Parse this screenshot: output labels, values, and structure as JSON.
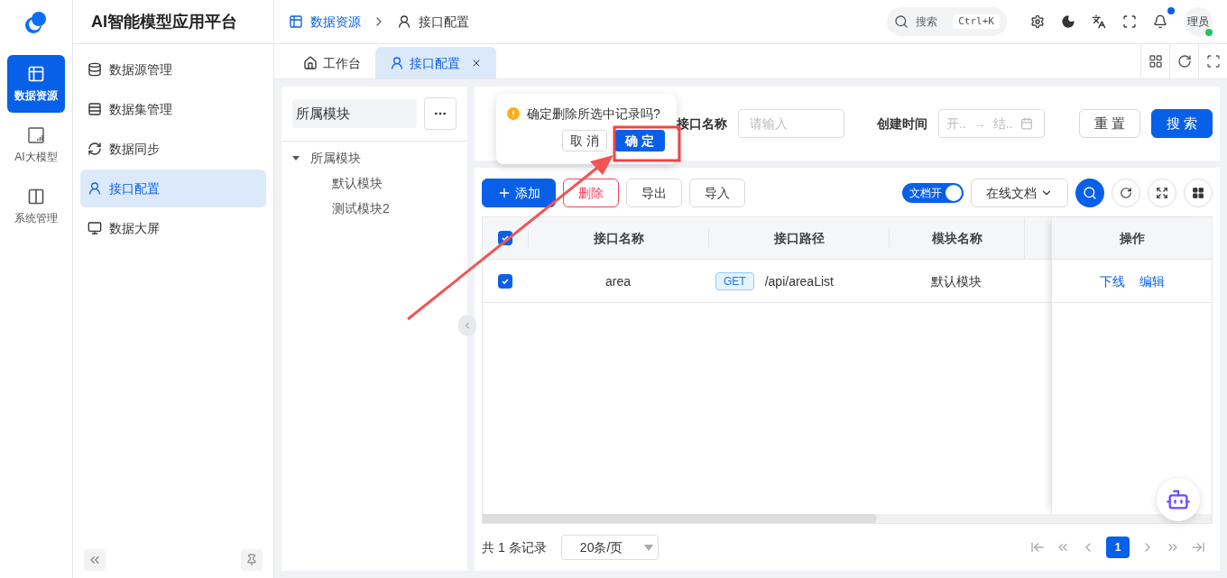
{
  "app": {
    "title": "AI智能模型应用平台"
  },
  "rail": [
    {
      "label": "数据资源",
      "selected": true
    },
    {
      "label": "AI大模型",
      "selected": false
    },
    {
      "label": "系统管理",
      "selected": false
    }
  ],
  "sidebar": {
    "items": [
      {
        "label": "数据源管理",
        "selected": false
      },
      {
        "label": "数据集管理",
        "selected": false
      },
      {
        "label": "数据同步",
        "selected": false
      },
      {
        "label": "接口配置",
        "selected": true
      },
      {
        "label": "数据大屏",
        "selected": false
      }
    ]
  },
  "breadcrumb": [
    "数据资源",
    "接口配置"
  ],
  "header": {
    "search": {
      "placeholder": "搜索",
      "shortcut": "Ctrl+K"
    },
    "notification": true,
    "avatar": {
      "label": "理员",
      "online": true
    }
  },
  "tabs": [
    {
      "label": "工作台",
      "selected": false,
      "closable": false
    },
    {
      "label": "接口配置",
      "selected": true,
      "closable": true
    }
  ],
  "tree": {
    "search": {
      "value": "所属模块"
    },
    "nodes": [
      {
        "label": "所属模块",
        "expanded": true,
        "children": [
          {
            "label": "默认模块"
          },
          {
            "label": "测试模块2"
          }
        ]
      }
    ]
  },
  "filters": [
    {
      "label": "接口名称",
      "kind": "text",
      "placeholder": "请输入"
    },
    {
      "label": "创建时间",
      "kind": "range",
      "start": "开..",
      "end": "结..",
      "separator": "→"
    }
  ],
  "filter_buttons": [
    {
      "label": "重 置",
      "primary": false
    },
    {
      "label": "搜 索",
      "primary": true
    }
  ],
  "popconfirm": {
    "message": "确定删除所选中记录吗?",
    "cancel": "取 消",
    "confirm": "确 定"
  },
  "toolbar": {
    "buttons": [
      {
        "label": "添加",
        "kind": "primary"
      },
      {
        "label": "删除",
        "kind": "danger"
      },
      {
        "label": "导出",
        "kind": "default"
      },
      {
        "label": "导入",
        "kind": "default"
      }
    ],
    "doc_switch": {
      "label": "文档开",
      "on": true
    },
    "doc_menu": "在线文档"
  },
  "table": {
    "all_checked": true,
    "columns": [
      "接口名称",
      "接口路径",
      "模块名称",
      "操作"
    ],
    "rows": [
      {
        "checked": true,
        "name": "area",
        "method": "GET",
        "path": "/api/areaList",
        "module": "默认模块",
        "actions": [
          "下线",
          "编辑"
        ]
      }
    ]
  },
  "pagination": {
    "total": "共 1 条记录",
    "page_size": "20条/页",
    "pages": [
      {
        "label": "1",
        "selected": true
      }
    ]
  }
}
